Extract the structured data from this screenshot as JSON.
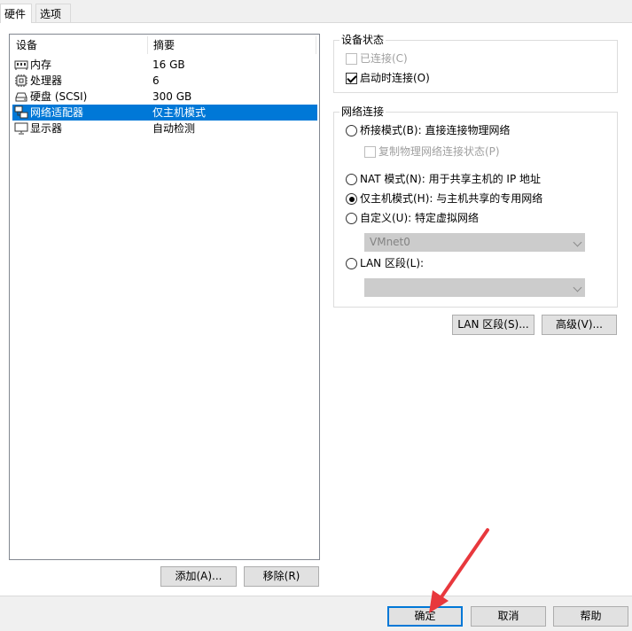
{
  "tabs": [
    {
      "label": "硬件",
      "active": true
    },
    {
      "label": "选项",
      "active": false
    }
  ],
  "device_list": {
    "columns": [
      "设备",
      "摘要"
    ],
    "rows": [
      {
        "icon": "memory-icon",
        "name": "内存",
        "summary": "16 GB",
        "selected": false
      },
      {
        "icon": "processor-icon",
        "name": "处理器",
        "summary": "6",
        "selected": false
      },
      {
        "icon": "disk-icon",
        "name": "硬盘 (SCSI)",
        "summary": "300 GB",
        "selected": false
      },
      {
        "icon": "network-adapter-icon",
        "name": "网络适配器",
        "summary": "仅主机模式",
        "selected": true
      },
      {
        "icon": "display-icon",
        "name": "显示器",
        "summary": "自动检测",
        "selected": false
      }
    ]
  },
  "left_buttons": {
    "add": "添加(A)...",
    "remove": "移除(R)"
  },
  "device_status": {
    "title": "设备状态",
    "connected": {
      "label": "已连接(C)",
      "checked": false,
      "enabled": false
    },
    "connect_at_power_on": {
      "label": "启动时连接(O)",
      "checked": true,
      "enabled": true
    }
  },
  "network_connection": {
    "title": "网络连接",
    "bridged": {
      "label": "桥接模式(B): 直接连接物理网络",
      "selected": false
    },
    "replicate": {
      "label": "复制物理网络连接状态(P)",
      "checked": false,
      "enabled": false
    },
    "nat": {
      "label": "NAT 模式(N): 用于共享主机的 IP 地址",
      "selected": false
    },
    "host_only": {
      "label": "仅主机模式(H): 与主机共享的专用网络",
      "selected": true
    },
    "custom": {
      "label": "自定义(U): 特定虚拟网络",
      "selected": false
    },
    "custom_select": "VMnet0",
    "lan_segment": {
      "label": "LAN 区段(L):",
      "selected": false
    },
    "lan_select": ""
  },
  "right_buttons": {
    "lan_segments": "LAN 区段(S)...",
    "advanced": "高级(V)..."
  },
  "dialog_buttons": {
    "ok": "确定",
    "cancel": "取消",
    "help": "帮助"
  },
  "colors": {
    "selection": "#0078d7",
    "annotation_arrow": "#e8383d"
  }
}
